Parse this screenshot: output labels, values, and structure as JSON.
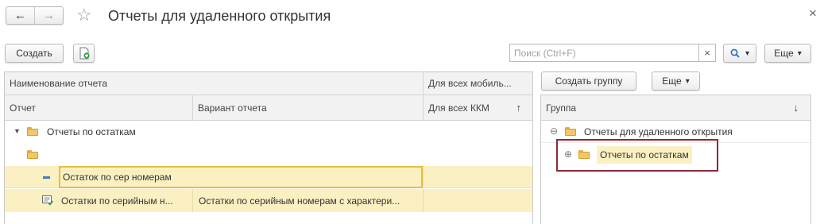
{
  "window": {
    "title": "Отчеты для удаленного открытия",
    "close": "×"
  },
  "nav": {
    "back": "←",
    "forward": "→",
    "star": "☆"
  },
  "toolbar_left": {
    "create_label": "Создать"
  },
  "search": {
    "placeholder": "Поиск (Ctrl+F)",
    "clear": "×",
    "search_icon": "🔍",
    "dropdown": "▾",
    "more_label": "Еще"
  },
  "toolbar_right": {
    "create_group_label": "Создать группу",
    "more_label": "Еще"
  },
  "left_table": {
    "header_top": {
      "name": "Наименование отчета",
      "all_mobile": "Для всех мобиль..."
    },
    "header_bottom": {
      "report": "Отчет",
      "variant": "Вариант отчета",
      "all_kkm": "Для всех ККМ",
      "sort_arrow": "↑"
    },
    "rows": [
      {
        "label": "Отчеты по остаткам",
        "variant": ""
      },
      {
        "label": "",
        "variant": ""
      },
      {
        "label": "Остаток по сер номерам",
        "variant": ""
      },
      {
        "label": "Остатки по серийным н...",
        "variant": "Остатки по серийным номерам с характери..."
      }
    ]
  },
  "right_table": {
    "header": {
      "group": "Группа",
      "sort_arrow": "↓"
    },
    "rows": [
      {
        "label": "Отчеты для удаленного открытия",
        "toggle": "⊖"
      },
      {
        "label": "Отчеты по остаткам",
        "toggle": "⊕"
      }
    ]
  },
  "colors": {
    "selected_row": "#fbf0c2",
    "highlight_border": "#8b2a3a",
    "active_cell_border": "#e6c13a"
  }
}
